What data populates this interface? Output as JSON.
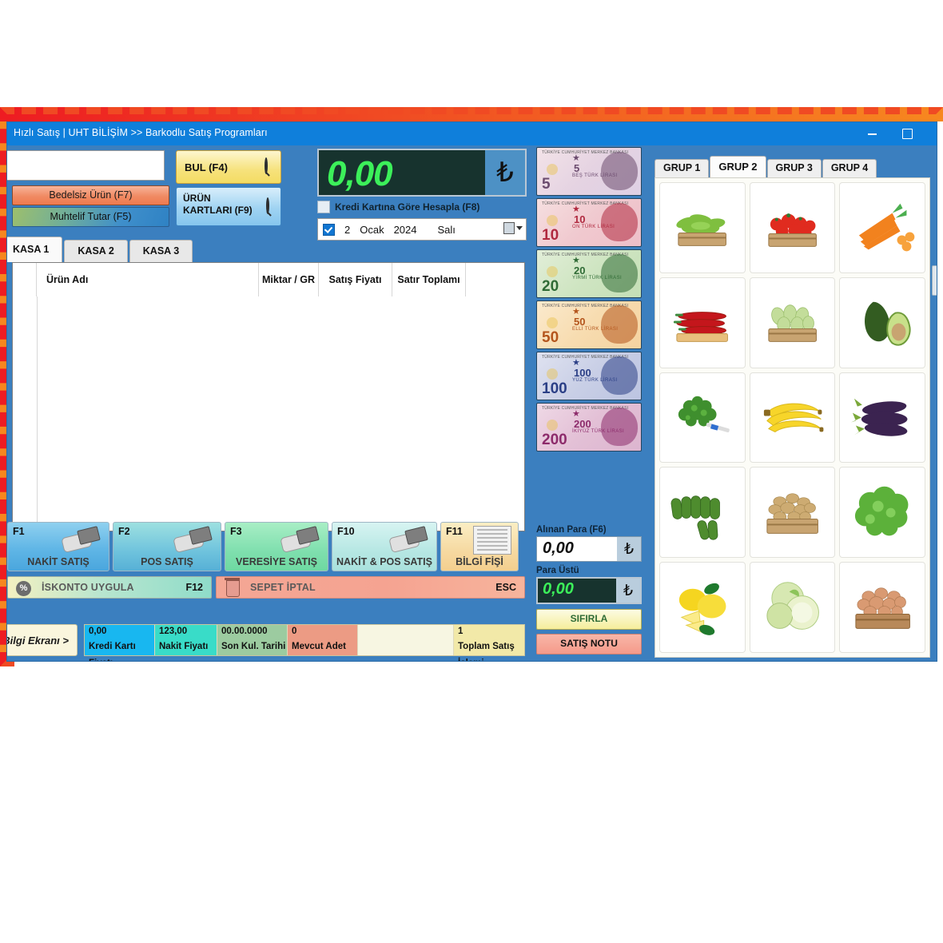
{
  "window": {
    "title": "Hızlı Satış | UHT BİLİŞİM >> Barkodlu Satış Programları",
    "minimize_icon": "minimize-icon",
    "maximize_icon": "maximize-icon"
  },
  "toolbar": {
    "barcode_input_value": "",
    "barcode_input_placeholder": "",
    "bedelsiz_label": "Bedelsiz Ürün (F7)",
    "muhtelif_label": "Muhtelif Tutar (F5)",
    "bul_label": "BUL (F4)",
    "urun_kartlari_label": "ÜRÜN KARTLARI (F9)",
    "search_icon": "magnifier-icon"
  },
  "total": {
    "value": "0,00",
    "currency_symbol": "₺",
    "credit_card_label": "Kredi Kartına Göre Hesapla (F8)",
    "credit_card_checked": false
  },
  "date": {
    "checked": true,
    "day": "2",
    "month": "Ocak",
    "year": "2024",
    "weekday": "Salı",
    "calendar_icon": "calendar-icon"
  },
  "kasa_tabs": [
    {
      "label": "KASA 1",
      "active": true
    },
    {
      "label": "KASA 2",
      "active": false
    },
    {
      "label": "KASA 3",
      "active": false
    }
  ],
  "grid": {
    "columns": [
      {
        "label": "Ürün Adı",
        "align": "left"
      },
      {
        "label": "Miktar / GR",
        "align": "center"
      },
      {
        "label": "Satış Fiyatı",
        "align": "center"
      },
      {
        "label": "Satır Toplamı",
        "align": "center"
      },
      {
        "label": "",
        "align": "center"
      }
    ],
    "rows": []
  },
  "payment_buttons": [
    {
      "key": "F1",
      "label": "NAKİT SATIŞ",
      "icon": "hand-cash-icon"
    },
    {
      "key": "F2",
      "label": "POS SATIŞ",
      "icon": "hand-card-icon"
    },
    {
      "key": "F3",
      "label": "VERESİYE SATIŞ",
      "icon": "hand-card-icon"
    },
    {
      "key": "F10",
      "label": "NAKİT & POS SATIŞ",
      "icon": "hand-card-icon"
    },
    {
      "key": "F11",
      "label": "BİLGİ FİŞİ",
      "icon": "receipt-icon"
    }
  ],
  "actions": {
    "iskonto_label": "İSKONTO UYGULA",
    "iskonto_key": "F12",
    "iskonto_icon": "percent-icon",
    "sepet_label": "SEPET İPTAL",
    "sepet_key": "ESC",
    "sepet_icon": "trash-icon"
  },
  "status": {
    "bilgi_label": "Bilgi Ekranı >",
    "fields": [
      {
        "value": "0,00",
        "label": "Kredi Kartı Fiyatı",
        "value_bg": "#18b7f0",
        "label_bg": "#18b7f0"
      },
      {
        "value": "123,00",
        "label": "Nakit Fiyatı",
        "value_bg": "#39dcc8",
        "label_bg": "#39dcc8"
      },
      {
        "value": "00.00.0000",
        "label": "Son Kul. Tarihi",
        "value_bg": "#9ccba0",
        "label_bg": "#9ccba0"
      },
      {
        "value": "0",
        "label": "Mevcut Adet",
        "value_bg": "#ec9b84",
        "label_bg": "#ec9b84"
      },
      {
        "value": "",
        "label": "",
        "value_bg": "#f7f6e2",
        "label_bg": "#f7f6e2"
      },
      {
        "value": "1",
        "label": "Toplam Satış İşlemi",
        "value_bg": "#f2e9a8",
        "label_bg": "#f2e9a8"
      }
    ]
  },
  "money_notes": [
    {
      "denomination": "5",
      "name": "TÜRK LİRASI",
      "bank": "TÜRKİYE CUMHURİYET MERKEZ BANKASI",
      "sub": "BEŞ TÜRK LİRASI"
    },
    {
      "denomination": "10",
      "name": "TÜRK LİRASI",
      "bank": "TÜRKİYE CUMHURİYET MERKEZ BANKASI",
      "sub": "ON TÜRK LİRASI"
    },
    {
      "denomination": "20",
      "name": "TÜRK LİRASI",
      "bank": "TÜRKİYE CUMHURİYET MERKEZ BANKASI",
      "sub": "YİRMİ TÜRK LİRASI"
    },
    {
      "denomination": "50",
      "name": "TÜRK LİRASI",
      "bank": "TÜRKİYE CUMHURİYET MERKEZ BANKASI",
      "sub": "ELLİ TÜRK LİRASI"
    },
    {
      "denomination": "100",
      "name": "TÜRK LİRASI",
      "bank": "TÜRKİYE CUMHURİYET MERKEZ BANKASI",
      "sub": "YÜZ TÜRK LİRASI"
    },
    {
      "denomination": "200",
      "name": "TÜRK LİRASI",
      "bank": "TÜRKİYE CUMHURİYET MERKEZ BANKASI",
      "sub": "İKİYÜZ TÜRK LİRASI"
    }
  ],
  "cash": {
    "alinan_label": "Alınan Para (F6)",
    "alinan_value": "0,00",
    "para_ustu_label": "Para Üstü",
    "para_ustu_value": "0,00",
    "currency_symbol": "₺",
    "sifirla_label": "SIFIRLA",
    "satis_notu_label": "SATIŞ NOTU"
  },
  "product_tabs": [
    {
      "label": "GRUP 1",
      "active": false
    },
    {
      "label": "GRUP 2",
      "active": true
    },
    {
      "label": "GRUP 3",
      "active": false
    },
    {
      "label": "GRUP 4",
      "active": false
    }
  ],
  "products": [
    {
      "icon": "green-pepper-crate-icon"
    },
    {
      "icon": "tomato-crate-icon"
    },
    {
      "icon": "carrot-icon"
    },
    {
      "icon": "red-pepper-icon"
    },
    {
      "icon": "zucchini-crate-icon"
    },
    {
      "icon": "avocado-icon"
    },
    {
      "icon": "parsley-icon"
    },
    {
      "icon": "banana-icon"
    },
    {
      "icon": "eggplant-icon"
    },
    {
      "icon": "cucumber-icon"
    },
    {
      "icon": "potato-crate-icon"
    },
    {
      "icon": "lettuce-icon"
    },
    {
      "icon": "lemon-icon"
    },
    {
      "icon": "cabbage-icon"
    },
    {
      "icon": "onion-crate-icon"
    }
  ],
  "colors": {
    "window_chrome": "#0f7fdb",
    "panel_blue": "#3b7fbf",
    "display_green": "#3cf05a",
    "display_bg": "#17332e",
    "selection_border_left": "#ee1c22",
    "selection_border_right": "#f7871f"
  }
}
